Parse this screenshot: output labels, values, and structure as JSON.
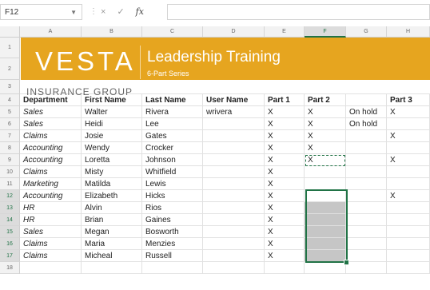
{
  "namebox": {
    "value": "F12"
  },
  "formula_bar": {
    "cancel_glyph": "×",
    "enter_glyph": "✓",
    "fx_label": "fx",
    "value": ""
  },
  "columns": [
    "A",
    "B",
    "C",
    "D",
    "E",
    "F",
    "G",
    "H"
  ],
  "selected_column": "F",
  "rows": [
    "1",
    "2",
    "3",
    "4",
    "5",
    "6",
    "7",
    "8",
    "9",
    "10",
    "11",
    "12",
    "13",
    "14",
    "15",
    "16",
    "17",
    "18"
  ],
  "selected_rows": [
    "12",
    "13",
    "14",
    "15",
    "16",
    "17"
  ],
  "banner": {
    "logo": "VESTA",
    "title": "Leadership Training",
    "subtitle": "6-Part Series",
    "company": "INSURANCE GROUP",
    "color": "#e6a51f"
  },
  "headers": [
    "Department",
    "First Name",
    "Last Name",
    "User Name",
    "Part 1",
    "Part 2",
    "",
    "Part 3"
  ],
  "table": [
    [
      "Sales",
      "Walter",
      "Rivera",
      "wrivera",
      "X",
      "X",
      "On hold",
      "X"
    ],
    [
      "Sales",
      "Heidi",
      "Lee",
      "",
      "X",
      "X",
      "On hold",
      ""
    ],
    [
      "Claims",
      "Josie",
      "Gates",
      "",
      "X",
      "X",
      "",
      "X"
    ],
    [
      "Accounting",
      "Wendy",
      "Crocker",
      "",
      "X",
      "X",
      "",
      ""
    ],
    [
      "Accounting",
      "Loretta",
      "Johnson",
      "",
      "X",
      "X",
      "",
      "X"
    ],
    [
      "Claims",
      "Misty",
      "Whitfield",
      "",
      "X",
      "",
      "",
      ""
    ],
    [
      "Marketing",
      "Matilda",
      "Lewis",
      "",
      "X",
      "",
      "",
      ""
    ],
    [
      "Accounting",
      "Elizabeth",
      "Hicks",
      "",
      "X",
      "",
      "",
      "X"
    ],
    [
      "HR",
      "Alvin",
      "Rios",
      "",
      "X",
      "",
      "",
      ""
    ],
    [
      "HR",
      "Brian",
      "Gaines",
      "",
      "X",
      "",
      "",
      ""
    ],
    [
      "Sales",
      "Megan",
      "Bosworth",
      "",
      "X",
      "",
      "",
      ""
    ],
    [
      "Claims",
      "Maria",
      "Menzies",
      "",
      "X",
      "",
      "",
      ""
    ],
    [
      "Claims",
      "Micheal",
      "Russell",
      "",
      "X",
      "",
      "",
      ""
    ]
  ],
  "accent_color": "#217346"
}
